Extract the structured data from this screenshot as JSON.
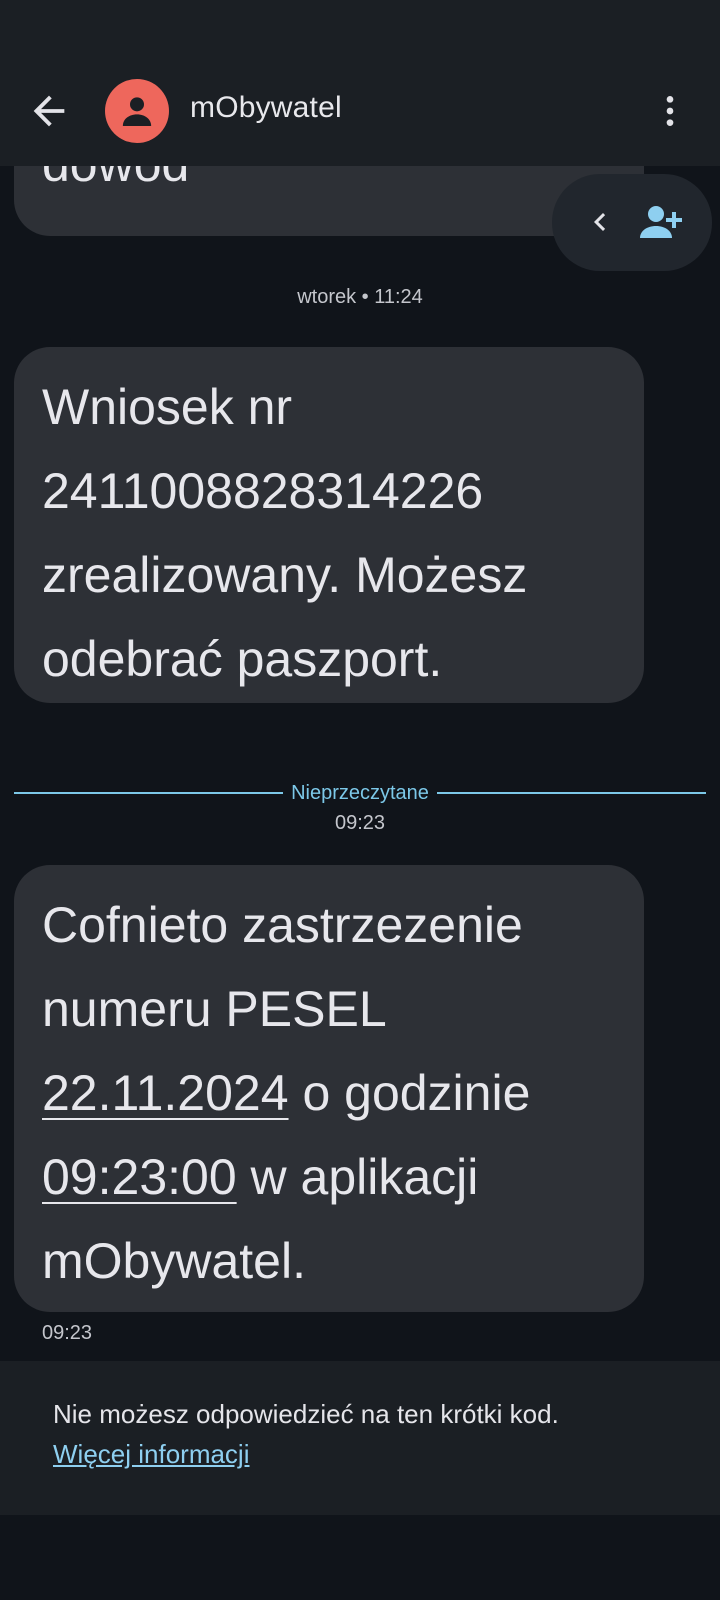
{
  "header": {
    "title": "mObywatel",
    "icons": {
      "back": "arrow-back-icon",
      "avatar": "person-icon",
      "more": "more-vert-icon"
    }
  },
  "floating_actions": {
    "icons": [
      "chevron-left-icon",
      "add-person-icon"
    ]
  },
  "messages": [
    {
      "text_partial": "dowod"
    },
    {
      "day_label": "wtorek • 11:24",
      "lines": [
        "Wniosek nr",
        "2411008828314226",
        "zrealizowany. Możesz",
        "odebrać paszport."
      ]
    }
  ],
  "unread_divider": {
    "label": "Nieprzeczytane",
    "time": "09:23"
  },
  "latest_message": {
    "line1": "Cofnieto zastrzezenie",
    "line2": "numeru PESEL",
    "date_link": "22.11.2024",
    "after_date": " o godzinie",
    "time_link": "09:23:00",
    "after_time": " w aplikacji",
    "line5": "mObywatel.",
    "timestamp": "09:23"
  },
  "footer": {
    "notice": "Nie możesz odpowiedzieć na ten krótki kod.",
    "link": "Więcej informacji"
  },
  "colors": {
    "accent": "#7cc8e8",
    "avatar": "#ee675c",
    "bubble": "#2d3036",
    "link": "#8ecff0"
  }
}
